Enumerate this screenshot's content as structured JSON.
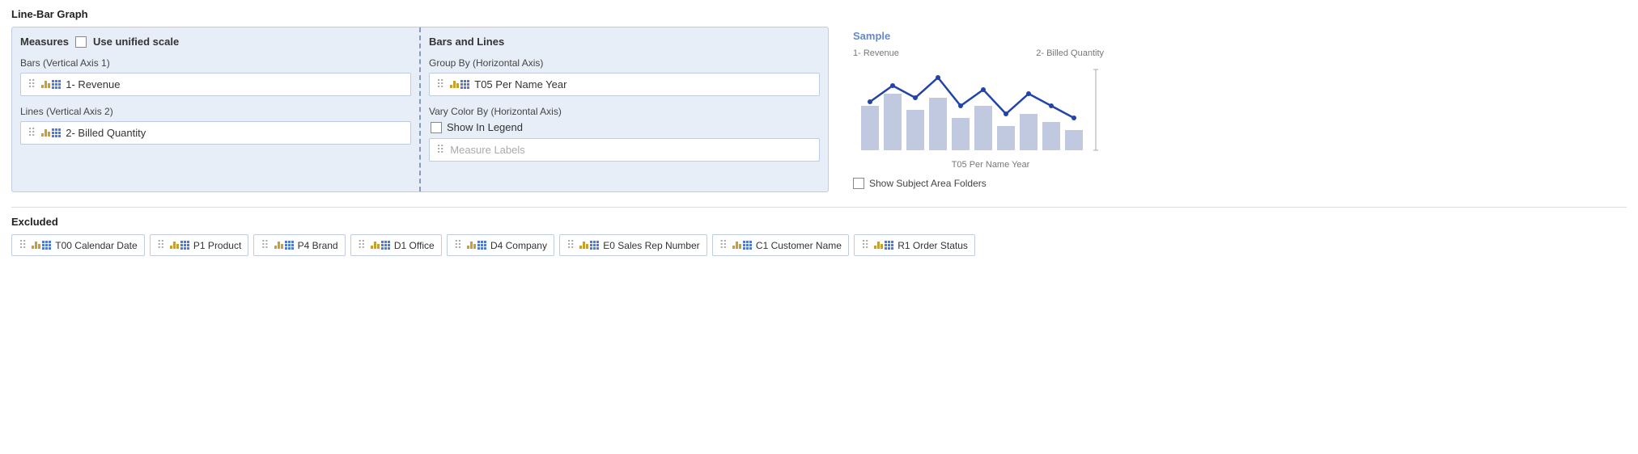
{
  "page": {
    "title": "Line-Bar Graph"
  },
  "measures_panel": {
    "header": "Measures",
    "unified_scale_label": "Use unified scale",
    "bars_axis_label": "Bars (Vertical Axis 1)",
    "bars_field": "1- Revenue",
    "lines_axis_label": "Lines (Vertical Axis 2)",
    "lines_field": "2- Billed Quantity"
  },
  "bars_lines_panel": {
    "header": "Bars and Lines",
    "group_by_label": "Group By (Horizontal Axis)",
    "group_by_field": "T05 Per Name Year",
    "vary_color_label": "Vary Color By (Horizontal Axis)",
    "show_legend_label": "Show In Legend",
    "measure_labels_placeholder": "Measure Labels"
  },
  "sample": {
    "title": "Sample",
    "label_left": "1- Revenue",
    "label_right": "2- Billed Quantity",
    "xlabel": "T05 Per Name Year",
    "show_subject_area_label": "Show Subject Area Folders"
  },
  "excluded": {
    "title": "Excluded",
    "items": [
      "T00 Calendar Date",
      "P1 Product",
      "P4 Brand",
      "D1 Office",
      "D4 Company",
      "E0 Sales Rep Number",
      "C1 Customer Name",
      "R1 Order Status"
    ]
  }
}
